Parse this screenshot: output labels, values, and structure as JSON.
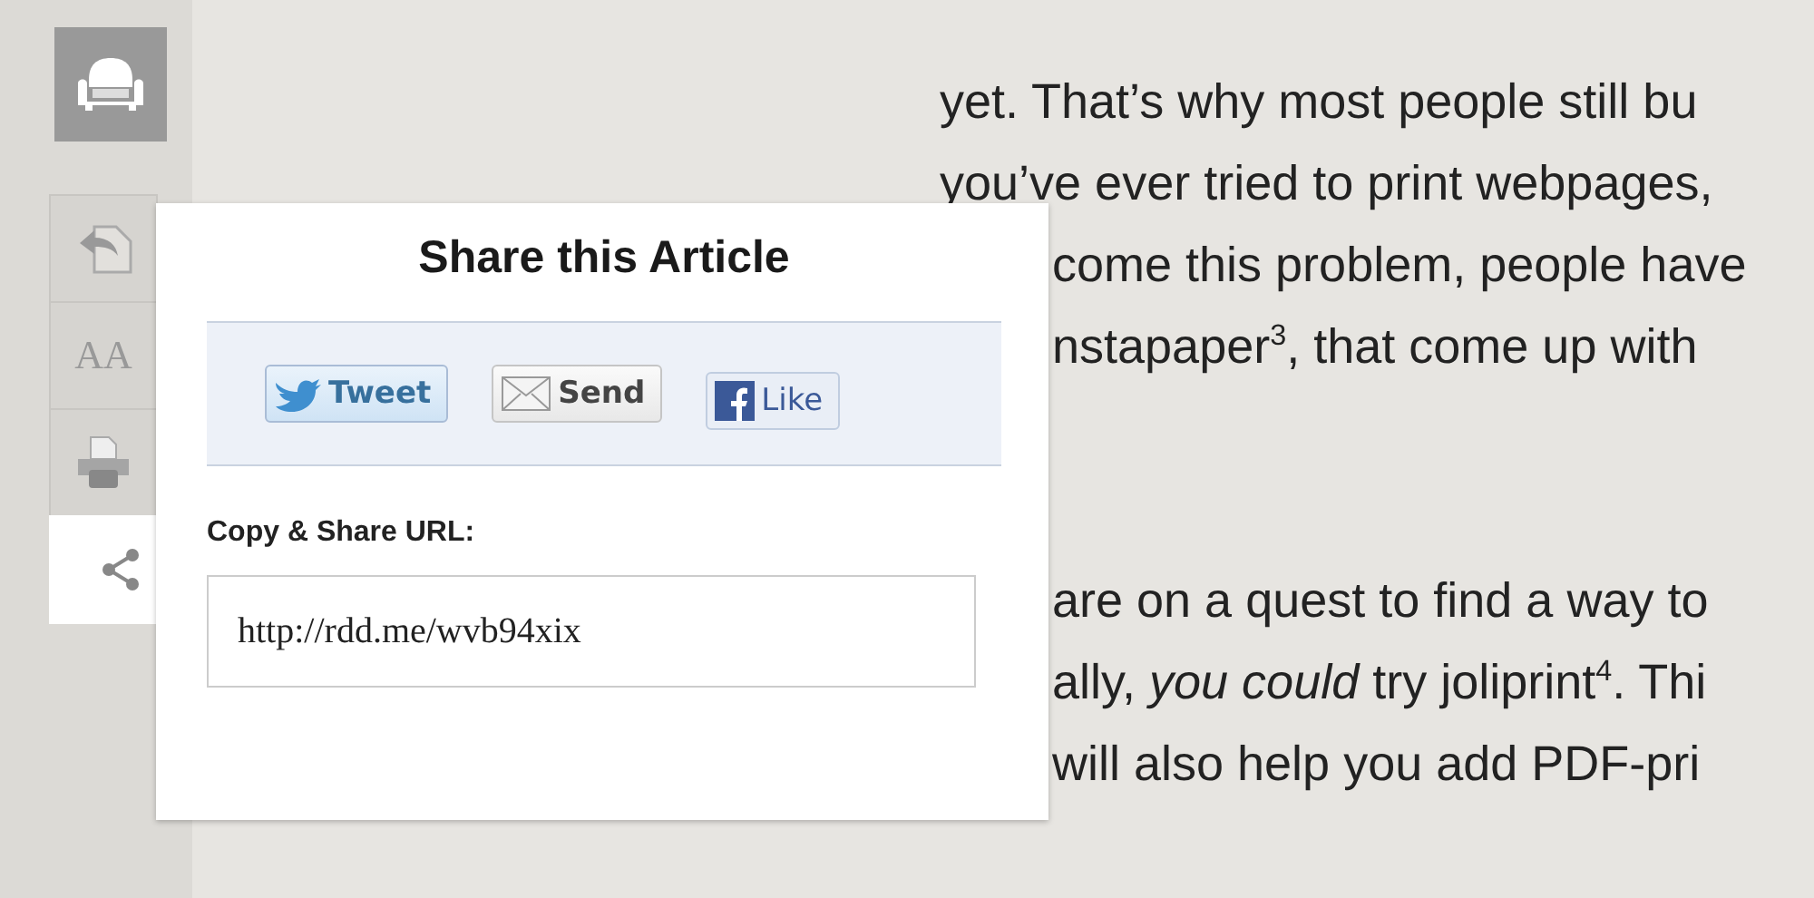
{
  "sidebar": {
    "tools": [
      {
        "kind": "back",
        "selected": false
      },
      {
        "kind": "text-size",
        "label": "AA",
        "selected": false
      },
      {
        "kind": "print",
        "selected": false
      },
      {
        "kind": "share",
        "selected": true
      }
    ]
  },
  "article": {
    "paragraphs": [
      {
        "lines_above_popup": [
          "yet. That’s why most people still bu",
          "you’ve ever tried to print webpages,"
        ],
        "lines_beside_popup": [
          "come this problem, people have",
          "nstapaper$^{3}$, that come up with"
        ]
      },
      {
        "lines_beside_popup": [
          "are on a quest to find a way to",
          "ally, *you could* try joliprint$^{4}$. Thi",
          "will also help you add PDF-pri"
        ]
      }
    ]
  },
  "share_popup": {
    "title": "Share this Article",
    "buttons": [
      {
        "kind": "tweet",
        "label": "Tweet"
      },
      {
        "kind": "send",
        "label": "Send"
      },
      {
        "kind": "like",
        "label": "Like"
      }
    ],
    "url_label": "Copy & Share URL:",
    "url_value": "http://rdd.me/wvb94xix"
  }
}
